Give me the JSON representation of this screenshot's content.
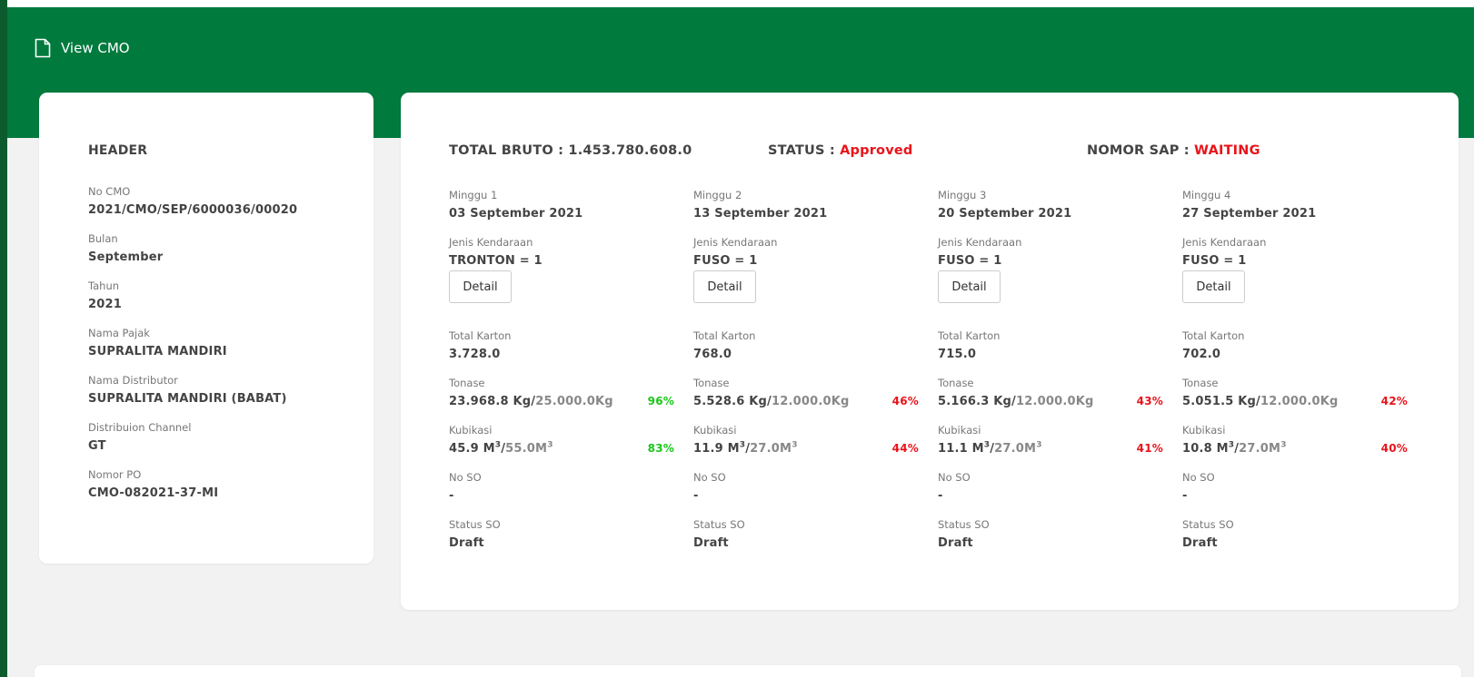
{
  "page": {
    "title": "View CMO"
  },
  "colors": {
    "brand_green": "#017a3e",
    "dark_green": "#0b5b2e",
    "alert_red": "#e8141b",
    "ok_green": "#19c719"
  },
  "header_card": {
    "title": "HEADER",
    "fields": [
      {
        "label": "No CMO",
        "value": "2021/CMO/SEP/6000036/00020"
      },
      {
        "label": "Bulan",
        "value": "September"
      },
      {
        "label": "Tahun",
        "value": "2021"
      },
      {
        "label": "Nama Pajak",
        "value": "SUPRALITA MANDIRI"
      },
      {
        "label": "Nama Distributor",
        "value": "SUPRALITA MANDIRI (BABAT)"
      },
      {
        "label": "Distribuion Channel",
        "value": "GT"
      },
      {
        "label": "Nomor PO",
        "value": "CMO-082021-37-MI"
      }
    ]
  },
  "summary": {
    "total_bruto_label": "TOTAL BRUTO :",
    "total_bruto_value": "1.453.780.608.0",
    "status_label": "STATUS :",
    "status_value": "Approved",
    "sap_label": "NOMOR SAP :",
    "sap_value": "WAITING"
  },
  "labels": {
    "jenis_kendaraan": "Jenis Kendaraan",
    "detail_button": "Detail",
    "total_karton": "Total Karton",
    "tonase": "Tonase",
    "kubikasi": "Kubikasi",
    "no_so": "No SO",
    "status_so": "Status SO",
    "kg_unit": "Kg",
    "m_unit": "M",
    "cube": "3",
    "slash": "/"
  },
  "weeks": [
    {
      "label": "Minggu 1",
      "date": "03 September 2021",
      "vehicle": "TRONTON = 1",
      "total_karton": "3.728.0",
      "tonase_value": "23.968.8",
      "tonase_capacity": "25.000.0Kg",
      "tonase_pct": "96%",
      "kubikasi_value": "45.9",
      "kubikasi_capacity": "55.0M",
      "kubikasi_pct": "83%",
      "no_so": "-",
      "status_so": "Draft"
    },
    {
      "label": "Minggu 2",
      "date": "13 September 2021",
      "vehicle": "FUSO = 1",
      "total_karton": "768.0",
      "tonase_value": "5.528.6",
      "tonase_capacity": "12.000.0Kg",
      "tonase_pct": "46%",
      "kubikasi_value": "11.9",
      "kubikasi_capacity": "27.0M",
      "kubikasi_pct": "44%",
      "no_so": "-",
      "status_so": "Draft"
    },
    {
      "label": "Minggu 3",
      "date": "20 September 2021",
      "vehicle": "FUSO = 1",
      "total_karton": "715.0",
      "tonase_value": "5.166.3",
      "tonase_capacity": "12.000.0Kg",
      "tonase_pct": "43%",
      "kubikasi_value": "11.1",
      "kubikasi_capacity": "27.0M",
      "kubikasi_pct": "41%",
      "no_so": "-",
      "status_so": "Draft"
    },
    {
      "label": "Minggu 4",
      "date": "27 September 2021",
      "vehicle": "FUSO = 1",
      "total_karton": "702.0",
      "tonase_value": "5.051.5",
      "tonase_capacity": "12.000.0Kg",
      "tonase_pct": "42%",
      "kubikasi_value": "10.8",
      "kubikasi_capacity": "27.0M",
      "kubikasi_pct": "40%",
      "no_so": "-",
      "status_so": "Draft"
    }
  ]
}
